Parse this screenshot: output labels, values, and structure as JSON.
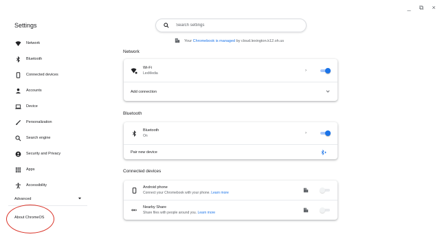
{
  "window": {
    "minimize": "_",
    "restore": "⧉",
    "close": "×"
  },
  "app_title": "Settings",
  "search": {
    "placeholder": "Search settings"
  },
  "managed": {
    "prefix": "Your",
    "link": "Chromebook is managed",
    "suffix": "by cloud.lexington.k12.oh.us"
  },
  "sidebar": {
    "items": [
      {
        "label": "Network",
        "icon": "wifi-icon"
      },
      {
        "label": "Bluetooth",
        "icon": "bluetooth-icon"
      },
      {
        "label": "Connected devices",
        "icon": "phone-icon"
      },
      {
        "label": "Accounts",
        "icon": "person-icon"
      },
      {
        "label": "Device",
        "icon": "laptop-icon"
      },
      {
        "label": "Personalization",
        "icon": "brush-icon"
      },
      {
        "label": "Search engine",
        "icon": "search-icon"
      },
      {
        "label": "Security and Privacy",
        "icon": "shield-icon"
      },
      {
        "label": "Apps",
        "icon": "apps-grid-icon"
      },
      {
        "label": "Accessibility",
        "icon": "accessibility-icon"
      }
    ],
    "advanced": "Advanced",
    "about": "About ChromeOS"
  },
  "network": {
    "title": "Network",
    "wifi": {
      "label": "Wi-Fi",
      "sub": "LexMedia",
      "enabled": true
    },
    "add_connection": "Add connection"
  },
  "bluetooth": {
    "title": "Bluetooth",
    "bt": {
      "label": "Bluetooth",
      "sub": "On",
      "enabled": true
    },
    "pair": "Pair new device"
  },
  "connected": {
    "title": "Connected devices",
    "phone": {
      "label": "Android phone",
      "sub": "Connect your Chromebook with your phone.",
      "link": "Learn more",
      "enabled": false
    },
    "share": {
      "label": "Nearby Share",
      "sub": "Share files with people around you.",
      "link": "Learn more",
      "enabled": false
    }
  },
  "colors": {
    "accent": "#1a73e8",
    "annotation": "#d93025"
  }
}
